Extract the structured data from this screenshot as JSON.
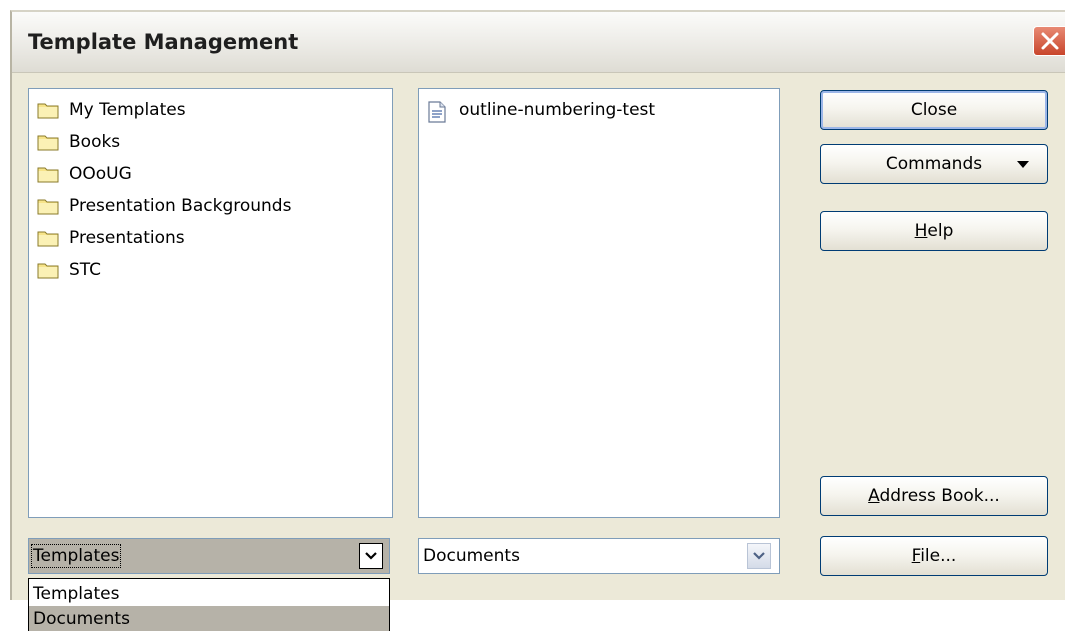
{
  "window": {
    "title": "Template Management"
  },
  "categories": {
    "items": [
      {
        "label": "My Templates"
      },
      {
        "label": "Books"
      },
      {
        "label": "OOoUG"
      },
      {
        "label": "Presentation Backgrounds"
      },
      {
        "label": "Presentations"
      },
      {
        "label": "STC"
      }
    ]
  },
  "templates": {
    "items": [
      {
        "label": "outline-numbering-test"
      }
    ]
  },
  "buttons": {
    "close": "Close",
    "commands": "Commands",
    "help_mnemonic": "H",
    "help_rest": "elp",
    "address_book_mnemonic": "A",
    "address_book_rest": "ddress Book...",
    "file_mnemonic": "F",
    "file_rest": "ile..."
  },
  "left_combo": {
    "value": "Templates"
  },
  "right_combo": {
    "value": "Documents"
  },
  "left_dropdown": {
    "options": [
      {
        "label": "Templates",
        "selected": false
      },
      {
        "label": "Documents",
        "selected": true
      }
    ]
  },
  "colors": {
    "dialog_bg": "#ece9d8",
    "list_border": "#7f9db9",
    "button_border": "#003c74",
    "close_red": "#c8452b",
    "highlight": "#b6b2a8"
  }
}
